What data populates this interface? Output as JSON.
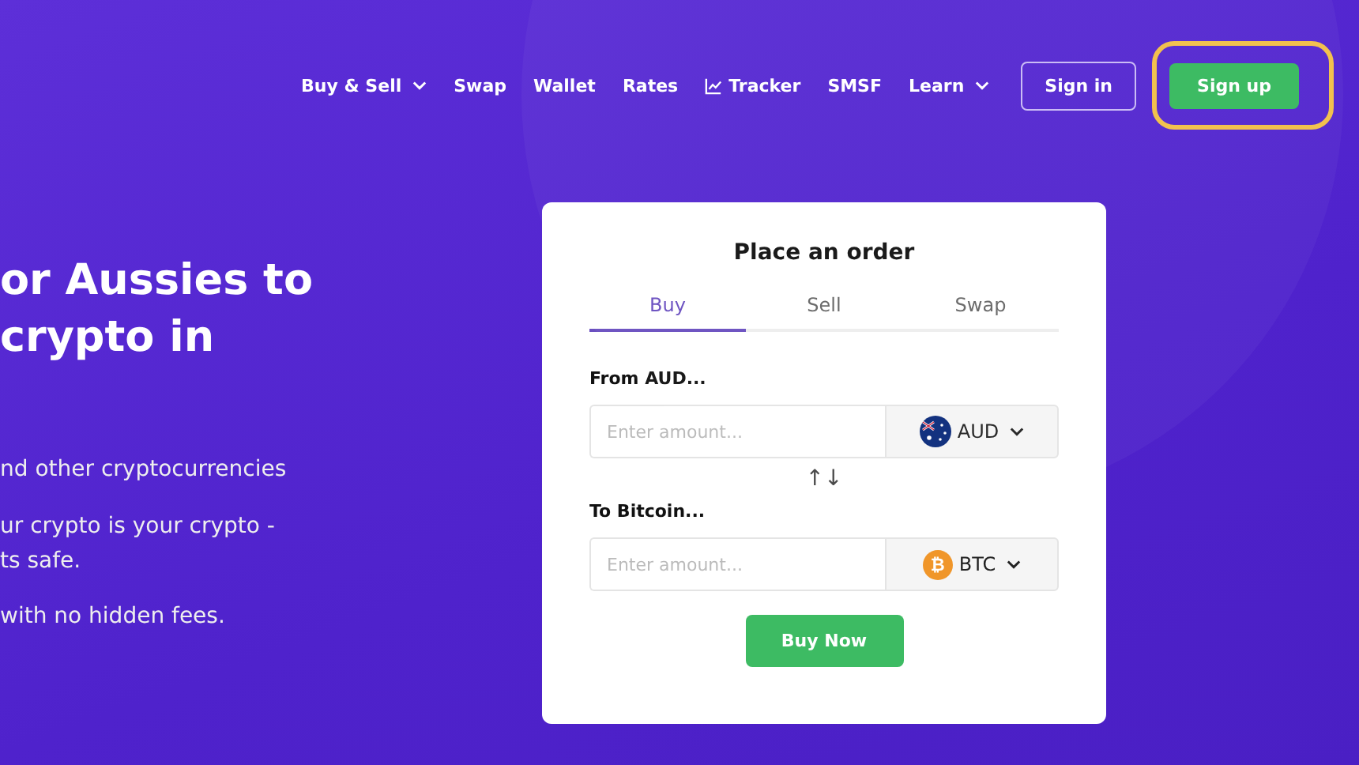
{
  "nav": {
    "items": [
      {
        "label": "Buy & Sell",
        "kind": "dropdown"
      },
      {
        "label": "Swap",
        "kind": "link"
      },
      {
        "label": "Wallet",
        "kind": "link"
      },
      {
        "label": "Rates",
        "kind": "link"
      },
      {
        "label": "Tracker",
        "kind": "chart-link"
      },
      {
        "label": "SMSF",
        "kind": "link"
      },
      {
        "label": "Learn",
        "kind": "dropdown"
      }
    ],
    "sign_in": "Sign in",
    "sign_up": {
      "label": "Sign up",
      "highlighted": true
    }
  },
  "hero": {
    "headline": [
      "or Aussies to",
      "crypto in"
    ],
    "paragraphs": [
      [
        "nd other cryptocurrencies"
      ],
      [
        "ur crypto is your crypto -",
        "ts safe."
      ],
      [
        "with no hidden fees."
      ]
    ]
  },
  "order": {
    "title": "Place an order",
    "tabs": [
      {
        "label": "Buy",
        "selected": true
      },
      {
        "label": "Sell",
        "selected": false
      },
      {
        "label": "Swap",
        "selected": false
      }
    ],
    "from": {
      "label": "From AUD...",
      "placeholder": "Enter amount...",
      "currency": "AUD",
      "kind": "flag"
    },
    "to": {
      "label": "To Bitcoin...",
      "placeholder": "Enter amount...",
      "currency": "BTC",
      "kind": "coin",
      "symbol": "₿"
    },
    "swap_symbol": "↑↓",
    "button": "Buy Now"
  }
}
